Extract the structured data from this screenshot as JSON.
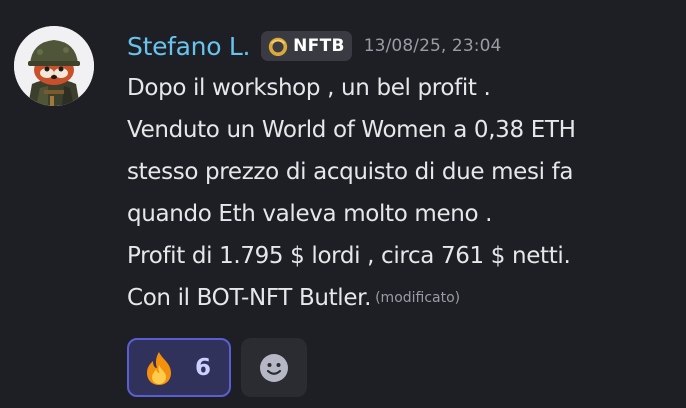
{
  "message": {
    "author": {
      "name": "Stefano L.",
      "avatar_icon": "red-panda-soldier-avatar",
      "tag": {
        "icon": "gold-ring-icon",
        "label": "NFTB"
      }
    },
    "timestamp": "13/08/25, 23:04",
    "lines": [
      "Dopo il workshop , un bel profit .",
      "Venduto un World of Women a 0,38 ETH",
      "stesso prezzo di acquisto di due mesi fa",
      "quando Eth valeva molto meno .",
      "Profit di 1.795 $ lordi , circa 761 $ netti.",
      "Con il BOT-NFT Butler."
    ],
    "edited_label": "(modificato)",
    "reactions": [
      {
        "emoji": "fire-emoji",
        "count": "6",
        "selected": true
      }
    ],
    "add_reaction_icon": "smiley-face-icon"
  },
  "colors": {
    "background": "#1e1f24",
    "username": "#68c3ee",
    "text": "#e6e7ea",
    "muted": "#9a9ca5",
    "reaction_selected_bg": "#31325c",
    "reaction_selected_border": "#5a5fd0"
  }
}
